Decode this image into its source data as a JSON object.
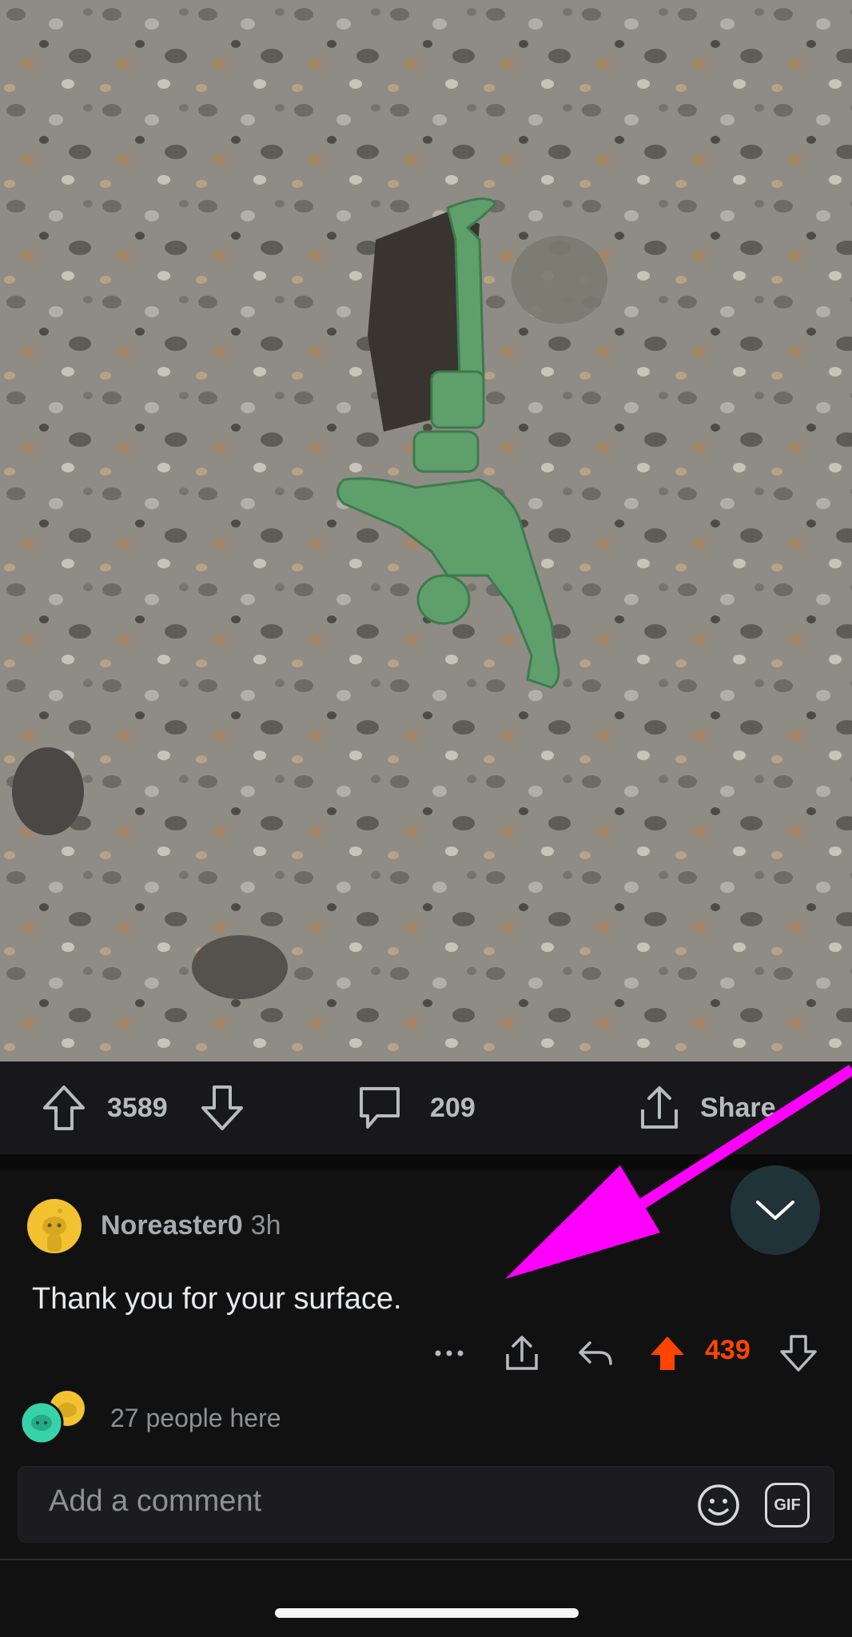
{
  "post": {
    "image_alt": "Green plastic toy soldier embedded in concrete",
    "upvotes": "3589",
    "comments": "209",
    "share_label": "Share"
  },
  "comment": {
    "author": "Noreaster0",
    "time": "3h",
    "body": "Thank you for your surface.",
    "score": "439"
  },
  "presence": {
    "label": "27 people here"
  },
  "composer": {
    "placeholder": "Add a comment",
    "gif_label": "GIF"
  },
  "colors": {
    "upvote_active": "#ff4500",
    "annotation_arrow": "#ff00ff",
    "background": "#111112"
  },
  "icons": [
    "upvote-icon",
    "downvote-icon",
    "comment-icon",
    "share-icon",
    "chevron-down-icon",
    "more-icon",
    "reply-icon",
    "emoji-icon",
    "gif-icon"
  ]
}
